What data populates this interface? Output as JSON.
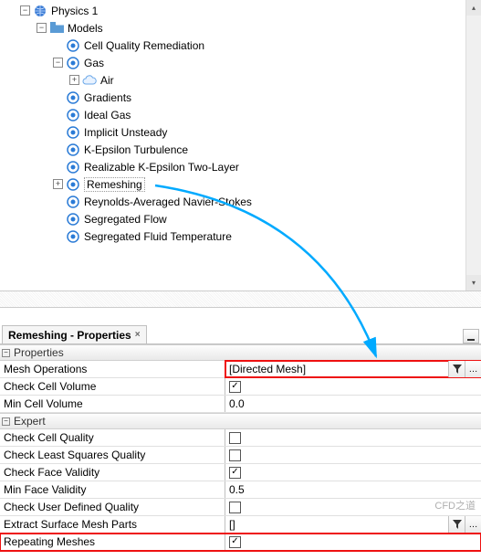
{
  "tree": {
    "root": {
      "label": "Physics 1"
    },
    "models": {
      "label": "Models"
    },
    "items": [
      {
        "label": "Cell Quality Remediation",
        "icon": "target"
      },
      {
        "label": "Gas",
        "icon": "target",
        "expandable": true,
        "expanded": true
      },
      {
        "label": "Air",
        "icon": "cloud",
        "depth": 1,
        "expandable": true,
        "expanded": false
      },
      {
        "label": "Gradients",
        "icon": "target"
      },
      {
        "label": "Ideal Gas",
        "icon": "target"
      },
      {
        "label": "Implicit Unsteady",
        "icon": "target"
      },
      {
        "label": "K-Epsilon Turbulence",
        "icon": "target"
      },
      {
        "label": "Realizable K-Epsilon Two-Layer",
        "icon": "target"
      },
      {
        "label": "Remeshing",
        "icon": "target",
        "expandable": true,
        "expanded": false,
        "selected": true
      },
      {
        "label": "Reynolds-Averaged Navier-Stokes",
        "icon": "target"
      },
      {
        "label": "Segregated Flow",
        "icon": "target"
      },
      {
        "label": "Segregated Fluid Temperature",
        "icon": "target"
      }
    ]
  },
  "propertiesTab": {
    "title": "Remeshing - Properties"
  },
  "sections": {
    "properties": "Properties",
    "expert": "Expert"
  },
  "props": {
    "meshOperations": {
      "label": "Mesh Operations",
      "value": "[Directed Mesh]",
      "hasButtons": true,
      "highlight": true
    },
    "checkCellVolume": {
      "label": "Check Cell Volume",
      "checked": true
    },
    "minCellVolume": {
      "label": "Min Cell Volume",
      "value": "0.0"
    },
    "checkCellQuality": {
      "label": "Check Cell Quality",
      "checked": false
    },
    "checkLeastSquares": {
      "label": "Check Least Squares Quality",
      "checked": false
    },
    "checkFaceValidity": {
      "label": "Check Face Validity",
      "checked": true
    },
    "minFaceValidity": {
      "label": "Min Face Validity",
      "value": "0.5"
    },
    "checkUserDefined": {
      "label": "Check User Defined Quality",
      "checked": false
    },
    "extractSurfaceMesh": {
      "label": "Extract Surface Mesh Parts",
      "value": "[]",
      "hasButtons": true
    },
    "repeatingMeshes": {
      "label": "Repeating Meshes",
      "checked": true,
      "highlight": true
    }
  },
  "icons": {
    "filter": "▼",
    "more": "…",
    "check": "✓"
  },
  "watermark": "CFD之道"
}
